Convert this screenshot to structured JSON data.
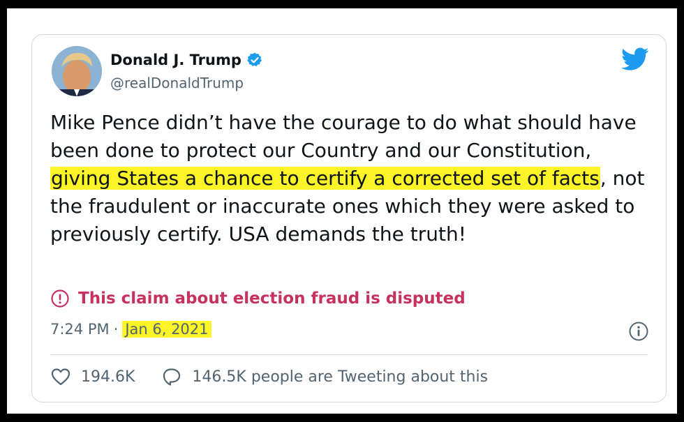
{
  "tweet": {
    "author": {
      "display_name": "Donald J. Trump",
      "handle": "@realDonaldTrump",
      "verified_icon": "verified-badge-icon"
    },
    "brand_icon": "twitter-bird-icon",
    "text": {
      "part1": "Mike Pence didn’t have the courage to do what should have been done to protect our Country and our Constitution, ",
      "highlight": "giving States a chance to certify a corrected set of facts",
      "part2": ", not the fraudulent or inaccurate ones which they were asked to previously certify. USA demands the truth!"
    },
    "warning": {
      "icon": "exclamation-circle-icon",
      "label": "This claim about election fraud is disputed"
    },
    "time": "7:24 PM",
    "separator": "·",
    "date": "Jan 6, 2021",
    "info_icon": "info-icon",
    "likes": "194.6K",
    "conversation": "146.5K people are Tweeting about this"
  },
  "colors": {
    "highlight": "#fbf426",
    "warning": "#c6315f",
    "twitter_blue": "#1d9bf0",
    "muted": "#536471"
  }
}
